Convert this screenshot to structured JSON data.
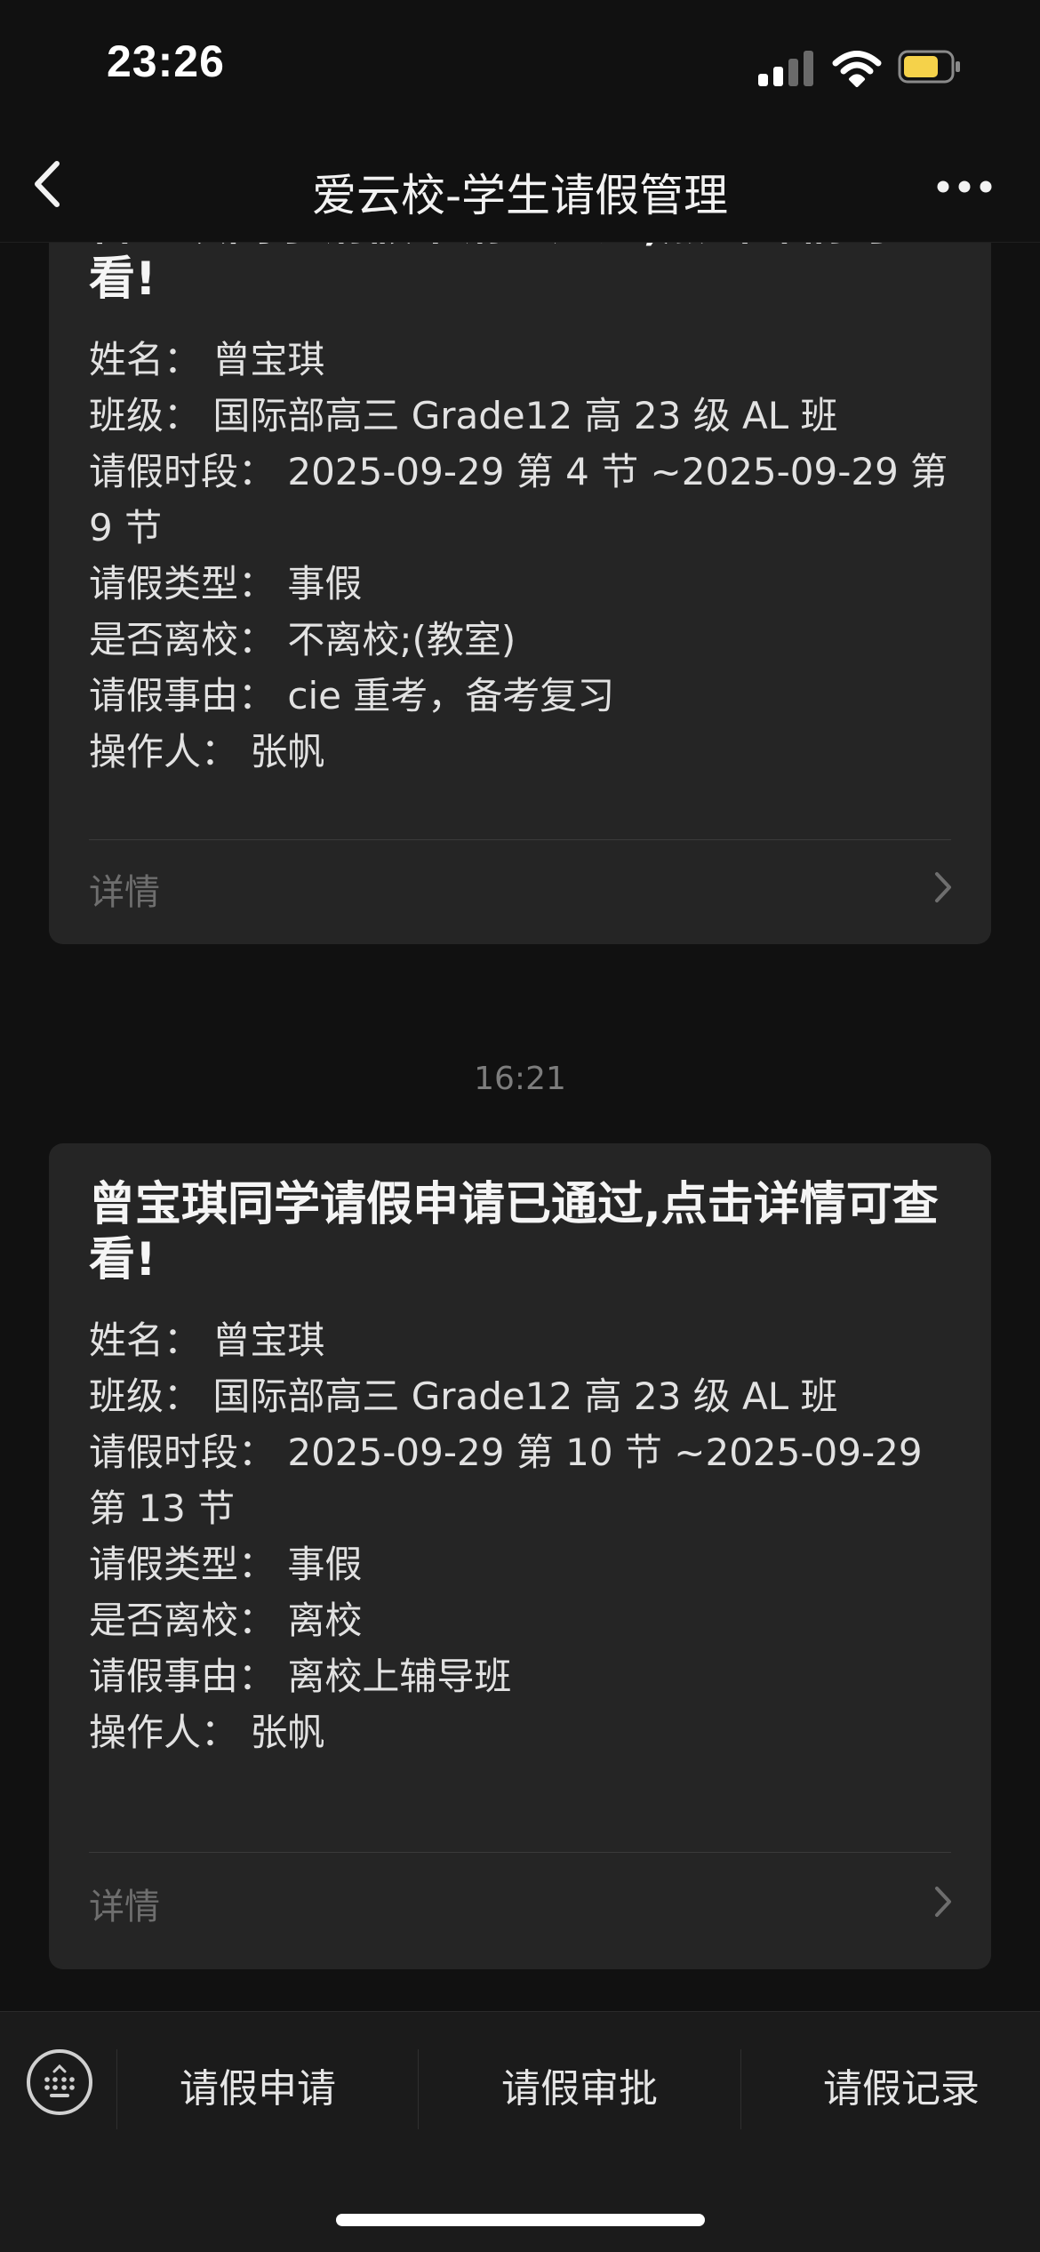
{
  "status_bar": {
    "time": "23:26"
  },
  "nav": {
    "title": "爱云校-学生请假管理"
  },
  "messages": [
    {
      "title": "曾宝琪同学请假申请已通过,点击详情可查看!",
      "fields": [
        "姓名：  曾宝琪",
        "班级：  国际部高三 Grade12 高 23 级 AL 班",
        "请假时段：  2025-09-29 第 4 节 ~2025-09-29 第 9 节",
        "请假类型：  事假",
        "是否离校：  不离校;(教室)",
        "请假事由：  cie 重考，备考复习",
        "操作人：  张帆"
      ],
      "detail_label": "详情"
    },
    {
      "timestamp": "16:21",
      "title": "曾宝琪同学请假申请已通过,点击详情可查看!",
      "fields": [
        "姓名：  曾宝琪",
        "班级：  国际部高三 Grade12 高 23 级 AL 班",
        "请假时段：  2025-09-29 第 10 节 ~2025-09-29 第 13 节",
        "请假类型：  事假",
        "是否离校：  离校",
        "请假事由：  离校上辅导班",
        "操作人：  张帆"
      ],
      "detail_label": "详情"
    }
  ],
  "bottom_menu": {
    "items": [
      "请假申请",
      "请假审批",
      "请假记录"
    ]
  },
  "colors": {
    "background": "#111111",
    "card": "#252525",
    "battery_fill": "#f5d24a"
  },
  "icons": [
    "signal-icon",
    "wifi-icon",
    "battery-icon",
    "back-arrow-icon",
    "more-dots-icon",
    "chevron-right-icon",
    "keyboard-icon"
  ]
}
